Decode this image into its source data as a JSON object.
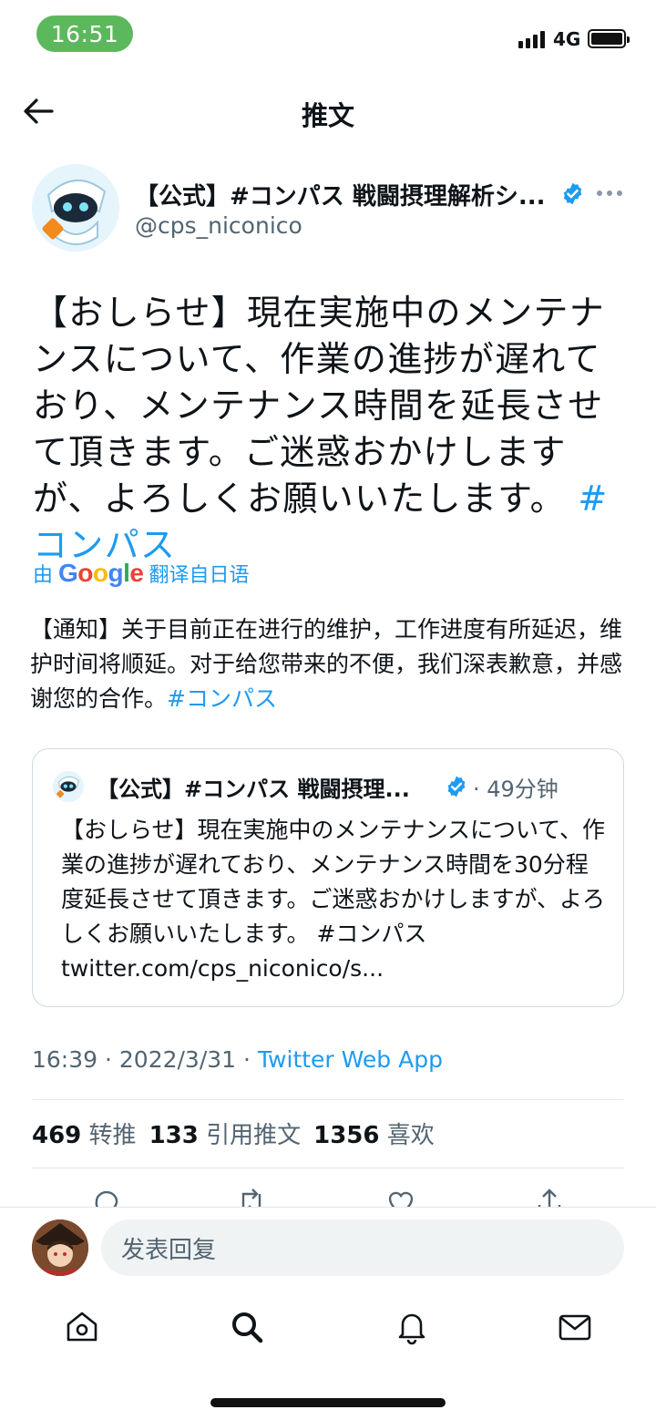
{
  "status_bar": {
    "time": "16:51",
    "network": "4G"
  },
  "header": {
    "title": "推文"
  },
  "author": {
    "name": "【公式】#コンパス 戦闘摂理解析シ...",
    "handle": "@cps_niconico"
  },
  "tweet": {
    "text": "【おしらせ】現在実施中のメンテナンスについて、作業の進捗が遅れており、メンテナンス時間を延長させて頂きます。ご迷惑おかけしますが、よろしくお願いいたします。",
    "hashtag": "#コンパス"
  },
  "translation": {
    "prefix": "由",
    "brand": "Google",
    "suffix": "翻译自日语",
    "text": "【通知】关于目前正在进行的维护，工作进度有所延迟，维护时间将顺延。对于给您带来的不便，我们深表歉意，并感谢您的合作。",
    "hashtag": "#コンパス"
  },
  "quoted_tweet": {
    "author_name": "【公式】#コンパス 戦闘摂理...",
    "time": "· 49分钟",
    "text": "【おしらせ】現在実施中のメンテナンスについて、作業の進捗が遅れており、メンテナンス時間を30分程度延長させて頂きます。ご迷惑おかけしますが、よろしくお願いいたします。 #コンパス twitter.com/cps_niconico/s..."
  },
  "meta": {
    "timestamp": "16:39 · 2022/3/31 · ",
    "source": "Twitter Web App"
  },
  "stats": {
    "retweets": "469",
    "retweets_label": "转推",
    "quotes": "133",
    "quotes_label": "引用推文",
    "likes": "1356",
    "likes_label": "喜欢"
  },
  "actions": [
    "reply-icon",
    "retweet-icon",
    "like-icon",
    "share-icon"
  ],
  "reply": {
    "placeholder": "发表回复"
  },
  "nav": [
    "home-icon",
    "search-icon",
    "notifications-icon",
    "messages-icon"
  ],
  "colors": {
    "accent": "#1d9bf0",
    "status_pill": "#5cb85c",
    "muted": "#536471"
  }
}
